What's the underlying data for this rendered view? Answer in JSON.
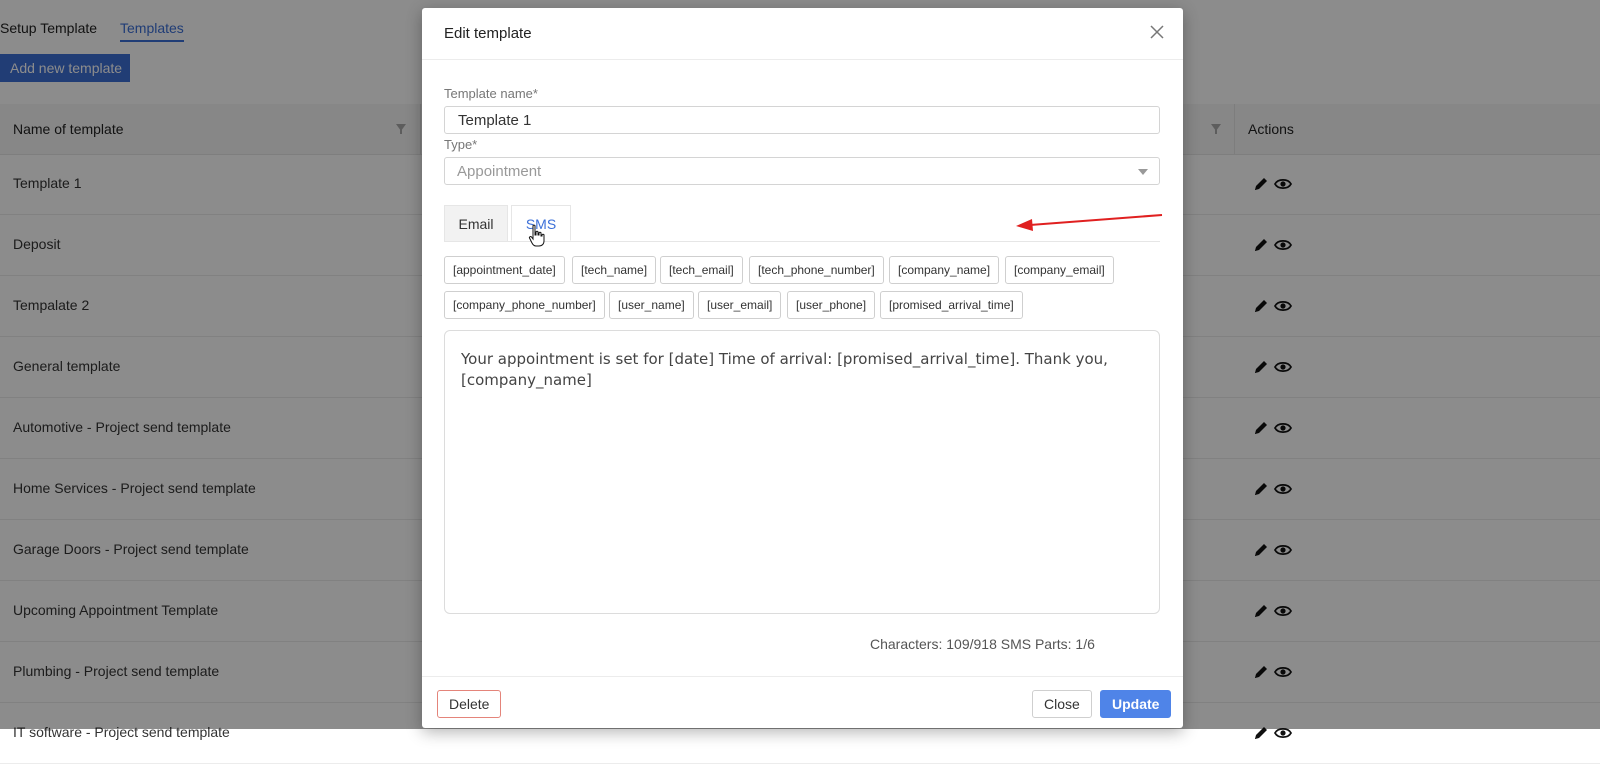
{
  "page": {
    "tabs": [
      "Setup Template",
      "Templates"
    ],
    "add_button": "Add new template",
    "columns": {
      "name": "Name of template",
      "actions": "Actions"
    },
    "rows": [
      "Template 1",
      "Deposit",
      "Tempalate 2",
      "General template",
      "Automotive - Project send template",
      "Home Services - Project send template",
      "Garage Doors - Project send template",
      "Upcoming Appointment Template",
      "Plumbing - Project send template",
      "IT software - Project send template"
    ]
  },
  "modal": {
    "title": "Edit template",
    "name_label": "Template name*",
    "name_value": "Template 1",
    "type_label": "Type*",
    "type_value": "Appointment",
    "tabs": {
      "email": "Email",
      "sms": "SMS",
      "active": "SMS"
    },
    "variables": [
      "[appointment_date]",
      "[tech_name]",
      "[tech_email]",
      "[tech_phone_number]",
      "[company_name]",
      "[company_email]",
      "[company_phone_number]",
      "[user_name]",
      "[user_email]",
      "[user_phone]",
      "[promised_arrival_time]"
    ],
    "message": "Your appointment is set for [date] Time of arrival: [promised_arrival_time]. Thank you, [company_name]",
    "char_count": "Characters: 109/918 SMS Parts: 1/6",
    "buttons": {
      "delete": "Delete",
      "close": "Close",
      "update": "Update"
    }
  },
  "colors": {
    "accent": "#3b6fd8",
    "primary_button": "#4f84e8",
    "annotation_arrow": "#e02020"
  }
}
